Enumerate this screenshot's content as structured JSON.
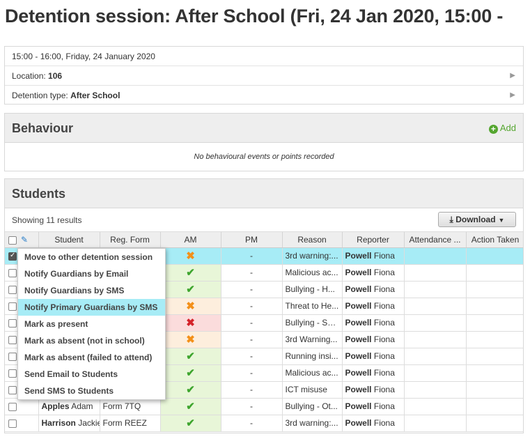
{
  "page": {
    "title_prefix": "Detention session: ",
    "title_main": "After School (Fri, 24 Jan 2020, 15:00 -"
  },
  "info": {
    "datetime": "15:00 - 16:00, Friday, 24 January 2020",
    "location_label": "Location: ",
    "location_value": "106",
    "type_label": "Detention type: ",
    "type_value": "After School"
  },
  "behaviour": {
    "heading": "Behaviour",
    "add_label": "Add",
    "empty": "No behavioural events or points recorded"
  },
  "students": {
    "heading": "Students",
    "showing": "Showing 11 results",
    "download": "Download",
    "columns": [
      "Student",
      "Reg. Form",
      "AM",
      "PM",
      "Reason",
      "Reporter",
      "Attendance ...",
      "Action Taken"
    ],
    "rows": [
      {
        "surname": "",
        "forename": "",
        "form": "",
        "am": "late",
        "pm": "-",
        "reason": "3rd warning:...",
        "rep_sur": "Powell",
        "rep_fore": "Fiona",
        "checked": true
      },
      {
        "surname": "",
        "forename": "",
        "form": "",
        "am": "good",
        "pm": "-",
        "reason": "Malicious ac...",
        "rep_sur": "Powell",
        "rep_fore": "Fiona",
        "checked": false
      },
      {
        "surname": "",
        "forename": "",
        "form": "",
        "am": "good",
        "pm": "-",
        "reason": "Bullying - H...",
        "rep_sur": "Powell",
        "rep_fore": "Fiona",
        "checked": false
      },
      {
        "surname": "",
        "forename": "",
        "form": "",
        "am": "late",
        "pm": "-",
        "reason": "Threat to He...",
        "rep_sur": "Powell",
        "rep_fore": "Fiona",
        "checked": false
      },
      {
        "surname": "",
        "forename": "",
        "form": "",
        "am": "bad",
        "pm": "-",
        "reason": "Bullying - Se...",
        "rep_sur": "Powell",
        "rep_fore": "Fiona",
        "checked": false
      },
      {
        "surname": "",
        "forename": "",
        "form": "",
        "am": "late",
        "pm": "-",
        "reason": "3rd Warning...",
        "rep_sur": "Powell",
        "rep_fore": "Fiona",
        "checked": false
      },
      {
        "surname": "",
        "forename": "",
        "form": "",
        "am": "good",
        "pm": "-",
        "reason": "Running insi...",
        "rep_sur": "Powell",
        "rep_fore": "Fiona",
        "checked": false
      },
      {
        "surname": "",
        "forename": "",
        "form": "",
        "am": "good",
        "pm": "-",
        "reason": "Malicious ac...",
        "rep_sur": "Powell",
        "rep_fore": "Fiona",
        "checked": false
      },
      {
        "surname": "",
        "forename": "",
        "form": "",
        "am": "good",
        "pm": "-",
        "reason": "ICT misuse",
        "rep_sur": "Powell",
        "rep_fore": "Fiona",
        "checked": false
      },
      {
        "surname": "Apples",
        "forename": "Adam",
        "form": "Form 7TQ",
        "am": "good",
        "pm": "-",
        "reason": "Bullying - Ot...",
        "rep_sur": "Powell",
        "rep_fore": "Fiona",
        "checked": false
      },
      {
        "surname": "Harrison",
        "forename": "Jackie",
        "form": "Form REEZ",
        "am": "good",
        "pm": "-",
        "reason": "3rd warning:...",
        "rep_sur": "Powell",
        "rep_fore": "Fiona",
        "checked": false
      }
    ]
  },
  "context_menu": [
    "Move to other detention session",
    "Notify Guardians by Email",
    "Notify Guardians by SMS",
    "Notify Primary Guardians by SMS",
    "Mark as present",
    "Mark as absent (not in school)",
    "Mark as absent (failed to attend)",
    "Send Email to Students",
    "Send SMS to Students"
  ],
  "context_menu_highlighted": 3,
  "marks": {
    "good": "✔",
    "late": "✖",
    "bad": "✖"
  },
  "colors": {
    "selected_row": "#a7ecf6",
    "present": "#3ea52e",
    "late": "#f39019",
    "absent": "#d4232a",
    "add_green": "#55a630"
  }
}
